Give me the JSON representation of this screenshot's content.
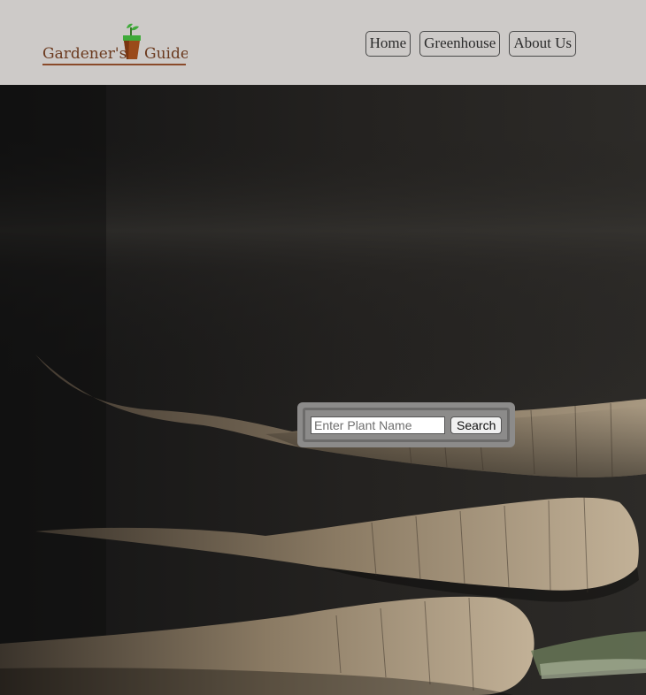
{
  "header": {
    "logo_text_left": "Gardener's",
    "logo_text_right": "Guide",
    "background_color": "#cdcac8"
  },
  "nav": {
    "items": [
      {
        "label": "Home"
      },
      {
        "label": "Greenhouse"
      },
      {
        "label": "About Us"
      }
    ]
  },
  "search": {
    "placeholder": "Enter Plant Name",
    "value": "",
    "button_label": "Search"
  },
  "icons": {
    "logo_pot": "potted-seedling-icon"
  },
  "colors": {
    "logo_text": "#6b3a1f",
    "pot": "#9a4a1a",
    "leaf": "#3faa3a"
  }
}
